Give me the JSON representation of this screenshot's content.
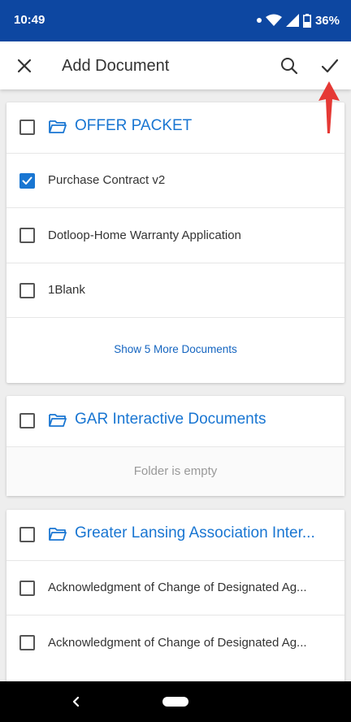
{
  "status_bar": {
    "time": "10:49",
    "battery_percent": "36%",
    "icons": [
      "dot-icon",
      "wifi-icon",
      "signal-icon",
      "battery-icon"
    ]
  },
  "app_bar": {
    "title": "Add Document",
    "icons": [
      "close-icon",
      "search-icon",
      "check-icon"
    ]
  },
  "colors": {
    "status_bar": "#0d47a1",
    "accent": "#1976d2",
    "annotation_arrow": "#e53935"
  },
  "folders": [
    {
      "name": "OFFER PACKET",
      "checked": false,
      "documents": [
        {
          "name": "Purchase Contract v2",
          "checked": true
        },
        {
          "name": "Dotloop-Home Warranty Application",
          "checked": false
        },
        {
          "name": "1Blank",
          "checked": false
        }
      ],
      "show_more": "Show 5 More Documents"
    },
    {
      "name": "GAR Interactive Documents",
      "checked": false,
      "documents": [],
      "empty_text": "Folder is empty"
    },
    {
      "name": "Greater Lansing Association Inter...",
      "checked": false,
      "documents": [
        {
          "name": "Acknowledgment of Change of Designated Ag...",
          "checked": false
        },
        {
          "name": "Acknowledgment of Change of Designated Ag...",
          "checked": false
        }
      ]
    }
  ],
  "nav_bar": {
    "icons": [
      "back-icon",
      "home-pill"
    ]
  }
}
